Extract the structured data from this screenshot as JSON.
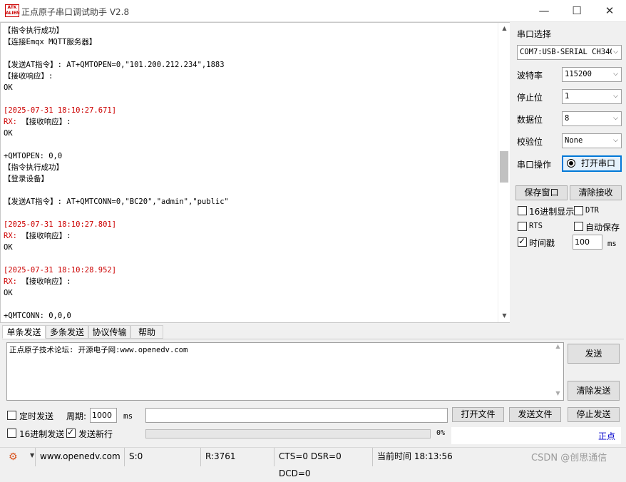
{
  "window": {
    "logo_text": "ATK\nALIENTEK",
    "title": "正点原子串口调试助手 V2.8",
    "minimize_glyph": "—",
    "maximize_glyph": "☐",
    "close_glyph": "✕"
  },
  "receive": {
    "lines": [
      {
        "text": "【指令执行成功】",
        "color": "black"
      },
      {
        "text": "【连接Emqx MQTT服务器】",
        "color": "black"
      },
      {
        "text": "",
        "color": "black"
      },
      {
        "text": "【发送AT指令】: AT+QMTOPEN=0,\"101.200.212.234\",1883",
        "color": "black"
      },
      {
        "text": "【接收响应】:",
        "color": "black"
      },
      {
        "text": "OK",
        "color": "black"
      },
      {
        "text": "",
        "color": "black"
      },
      {
        "text": "[2025-07-31 18:10:27.671]",
        "color": "red"
      },
      {
        "text": "RX: 【接收响应】:",
        "color": "rx"
      },
      {
        "text": "OK",
        "color": "black"
      },
      {
        "text": "",
        "color": "black"
      },
      {
        "text": "+QMTOPEN: 0,0",
        "color": "black"
      },
      {
        "text": "【指令执行成功】",
        "color": "black"
      },
      {
        "text": "【登录设备】",
        "color": "black"
      },
      {
        "text": "",
        "color": "black"
      },
      {
        "text": "【发送AT指令】: AT+QMTCONN=0,\"BC20\",\"admin\",\"public\"",
        "color": "black"
      },
      {
        "text": "",
        "color": "black"
      },
      {
        "text": "[2025-07-31 18:10:27.801]",
        "color": "red"
      },
      {
        "text": "RX: 【接收响应】:",
        "color": "rx"
      },
      {
        "text": "OK",
        "color": "black"
      },
      {
        "text": "",
        "color": "black"
      },
      {
        "text": "[2025-07-31 18:10:28.952]",
        "color": "red"
      },
      {
        "text": "RX: 【接收响应】:",
        "color": "rx"
      },
      {
        "text": "OK",
        "color": "black"
      },
      {
        "text": "",
        "color": "black"
      },
      {
        "text": "+QMTCONN: 0,0,0",
        "color": "black"
      }
    ]
  },
  "serial": {
    "port_label": "串口选择",
    "port_value": "COM7:USB-SERIAL CH340",
    "baud_label": "波特率",
    "baud_value": "115200",
    "stop_label": "停止位",
    "stop_value": "1",
    "data_label": "数据位",
    "data_value": "8",
    "parity_label": "校验位",
    "parity_value": "None",
    "op_label": "串口操作",
    "open_button": "打开串口"
  },
  "rx_controls": {
    "save_window": "保存窗口",
    "clear_receive": "清除接收",
    "hex_display": "16进制显示",
    "dtr": "DTR",
    "rts": "RTS",
    "auto_save": "自动保存",
    "timestamp": "时间戳",
    "timestamp_value": "100",
    "timestamp_unit": "ms"
  },
  "tabs": [
    "单条发送",
    "多条发送",
    "协议传输",
    "帮助"
  ],
  "send": {
    "text": "正点原子技术论坛: 开源电子网:www.openedv.com",
    "send_button": "发送",
    "clear_send_button": "清除发送",
    "timed_send": "定时发送",
    "period_label": "周期:",
    "period_value": "1000",
    "period_unit": "ms",
    "open_file": "打开文件",
    "send_file": "发送文件",
    "stop_send": "停止发送",
    "hex_send": "16进制发送",
    "send_newline": "发送新行",
    "progress_text": "0%",
    "progress": 0,
    "corner_text": "正点"
  },
  "status": {
    "url": "www.openedv.com",
    "sent": "S:0",
    "received": "R:3761",
    "signals": "CTS=0 DSR=0 DCD=0",
    "time": "当前时间 18:13:56",
    "watermark": "CSDN @创思通信"
  },
  "colors": {
    "timestamp_red": "#cc0000",
    "link_blue": "#0000cc"
  }
}
